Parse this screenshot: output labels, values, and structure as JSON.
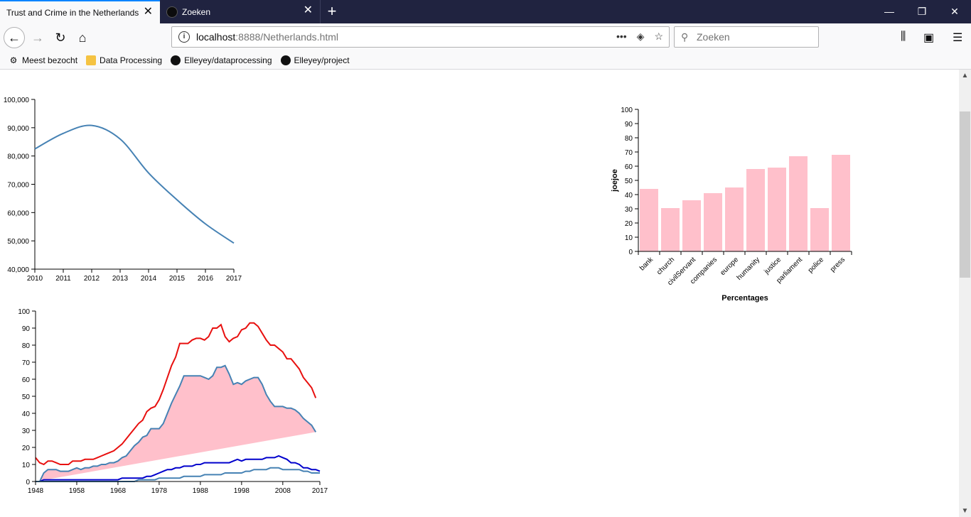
{
  "browser": {
    "tabs": [
      {
        "title": "Trust and Crime in the Netherlands",
        "active": true
      },
      {
        "title": "Zoeken",
        "active": false
      }
    ],
    "url_host": "localhost",
    "url_path": ":8888/Netherlands.html",
    "search_placeholder": "Zoeken",
    "bookmarks": [
      {
        "label": "Meest bezocht",
        "icon": "gear-icon"
      },
      {
        "label": "Data Processing",
        "icon": "folder-icon"
      },
      {
        "label": "Elleyey/dataprocessing",
        "icon": "github-icon"
      },
      {
        "label": "Elleyey/project",
        "icon": "github-icon"
      }
    ]
  },
  "chart_data": [
    {
      "type": "line",
      "x": [
        2010,
        2011,
        2012,
        2013,
        2014,
        2015,
        2016,
        2017
      ],
      "series": [
        {
          "values": [
            82500,
            88000,
            90800,
            86000,
            74000,
            64500,
            56000,
            49200
          ],
          "color": "#4682b4"
        }
      ],
      "xlim": [
        2010,
        2017
      ],
      "ylim": [
        40000,
        100000
      ],
      "yticks": [
        "40,000",
        "50,000",
        "60,000",
        "70,000",
        "80,000",
        "90,000",
        "100,000"
      ],
      "xticks": [
        "2010",
        "2011",
        "2012",
        "2013",
        "2014",
        "2015",
        "2016",
        "2017"
      ],
      "title": "",
      "xlabel": "",
      "ylabel": ""
    },
    {
      "type": "bar",
      "categories": [
        "bank",
        "church",
        "civilServant",
        "companies",
        "europe",
        "humanity",
        "justice",
        "parliament",
        "police",
        "press"
      ],
      "values": [
        44,
        30.5,
        36,
        41,
        45,
        58,
        59,
        67,
        30.5,
        68
      ],
      "ylim": [
        0,
        100
      ],
      "yticks": [
        "0",
        "10",
        "20",
        "30",
        "40",
        "50",
        "60",
        "70",
        "80",
        "90",
        "100"
      ],
      "xlabel": "Percentages",
      "ylabel": "joejoe",
      "bar_color": "#ffc0cb"
    },
    {
      "type": "area",
      "x": [
        1948,
        1949,
        1950,
        1951,
        1952,
        1953,
        1954,
        1955,
        1956,
        1957,
        1958,
        1959,
        1960,
        1961,
        1962,
        1963,
        1964,
        1965,
        1966,
        1967,
        1968,
        1969,
        1970,
        1971,
        1972,
        1973,
        1974,
        1975,
        1976,
        1977,
        1978,
        1979,
        1980,
        1981,
        1982,
        1983,
        1984,
        1985,
        1986,
        1987,
        1988,
        1989,
        1990,
        1991,
        1992,
        1993,
        1994,
        1995,
        1996,
        1997,
        1998,
        1999,
        2000,
        2001,
        2002,
        2003,
        2004,
        2005,
        2006,
        2007,
        2008,
        2009,
        2010,
        2011,
        2012,
        2013,
        2014,
        2015,
        2016,
        2017
      ],
      "series": [
        {
          "values": [
            14,
            11,
            10,
            12,
            12,
            11,
            10,
            10,
            10,
            12,
            12,
            12,
            13,
            13,
            13,
            14,
            15,
            16,
            17,
            18,
            20,
            22,
            25,
            28,
            31,
            34,
            36,
            41,
            43,
            44,
            48,
            54,
            61,
            68,
            73,
            81,
            81,
            81,
            83,
            84,
            84,
            83,
            85,
            90,
            90,
            92,
            85,
            82,
            84,
            85,
            89,
            90,
            93,
            93,
            91,
            87,
            83,
            80,
            80,
            78,
            76,
            72,
            72,
            69,
            66,
            61,
            58,
            55,
            49
          ],
          "color": "#e8100f"
        },
        {
          "values": [
            0,
            0,
            5,
            7,
            7,
            7,
            6,
            6,
            6,
            7,
            8,
            7,
            8,
            8,
            9,
            9,
            10,
            10,
            11,
            11,
            12,
            14,
            15,
            18,
            21,
            23,
            26,
            27,
            31,
            31,
            31,
            34,
            40,
            46,
            51,
            56,
            62,
            62,
            62,
            62,
            62,
            61,
            60,
            62,
            67,
            67,
            68,
            63,
            57,
            58,
            57,
            59,
            60,
            61,
            61,
            57,
            51,
            47,
            44,
            44,
            44,
            43,
            43,
            42,
            40,
            37,
            35,
            33,
            29
          ],
          "color": "#4682b4"
        },
        {
          "values": [
            0,
            0,
            1,
            1,
            1,
            1,
            1,
            1,
            1,
            1,
            1,
            1,
            1,
            1,
            1,
            1,
            1,
            1,
            1,
            1,
            1,
            2,
            2,
            2,
            2,
            2,
            2,
            3,
            3,
            4,
            5,
            6,
            7,
            7,
            8,
            8,
            9,
            9,
            9,
            10,
            10,
            11,
            11,
            11,
            11,
            11,
            11,
            11,
            12,
            13,
            12,
            13,
            13,
            13,
            13,
            13,
            14,
            14,
            14,
            15,
            14,
            13,
            11,
            11,
            10,
            8,
            8,
            7,
            7,
            6
          ],
          "color": "#0000cc"
        },
        {
          "values": [
            0,
            0,
            0,
            0,
            0,
            0,
            0,
            0,
            0,
            0,
            0,
            0,
            0,
            0,
            0,
            0,
            0,
            0,
            0,
            0,
            0,
            0,
            0,
            0,
            0,
            1,
            1,
            1,
            1,
            1,
            2,
            2,
            2,
            2,
            2,
            2,
            3,
            3,
            3,
            3,
            3,
            4,
            4,
            4,
            4,
            4,
            5,
            5,
            5,
            5,
            5,
            6,
            6,
            7,
            7,
            7,
            7,
            8,
            8,
            8,
            7,
            7,
            7,
            7,
            7,
            6,
            6,
            5,
            5,
            5
          ],
          "color": "#4682b4"
        }
      ],
      "fill_color": "#ffc0cb",
      "xlim": [
        1948,
        2017
      ],
      "ylim": [
        0,
        100
      ],
      "yticks": [
        "0",
        "10",
        "20",
        "30",
        "40",
        "50",
        "60",
        "70",
        "80",
        "90",
        "100"
      ],
      "xticks": [
        "1948",
        "1958",
        "1968",
        "1978",
        "1988",
        "1998",
        "2008",
        "2017"
      ],
      "title": "",
      "xlabel": "",
      "ylabel": ""
    }
  ]
}
